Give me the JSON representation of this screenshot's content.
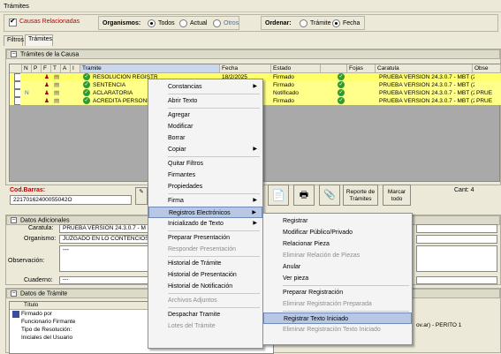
{
  "window": {
    "title": "Trámites"
  },
  "filters": {
    "causas_label": "Causas Relacionadas",
    "organismos_label": "Organismos:",
    "org_opts": [
      "Todos",
      "Actual",
      "Otros"
    ],
    "ordenar_label": "Ordenar:",
    "ord_opts": [
      "Trámite",
      "Fecha"
    ]
  },
  "tabs": [
    "Filtros",
    "Trámites"
  ],
  "tramites_panel": {
    "title": "Trámites de la Causa",
    "columns": [
      "N",
      "P",
      "F",
      "T",
      "A",
      "I",
      "Tramite",
      "Fecha",
      "Estado",
      "Fojas",
      "Caratula",
      "Obse"
    ],
    "rows": [
      {
        "tramite": "RESOLUCION REGISTRADA",
        "fecha": "18/2/2025",
        "estado": "Firmado",
        "caratula": "PRUEBA VERSION 24.3.0.7 - MBT (2)",
        "obs": ""
      },
      {
        "tramite": "SENTENCIA",
        "fecha": "18/2/2025",
        "estado": "Firmado",
        "caratula": "PRUEBA VERSION 24.3.0.7 - MBT (2)",
        "obs": ""
      },
      {
        "tramite": "ACLARATORIA",
        "fecha": "20/12/2024",
        "estado": "Notificado",
        "caratula": "PRUEBA VERSION 24.3.0.7 - MBT (2)",
        "obs": "PRUE"
      },
      {
        "tramite": "ACREDITA PERSONERIA",
        "fecha": "20/12/2024",
        "estado": "Firmado",
        "caratula": "PRUEBA VERSION 24.3.0.7 - MBT (2)",
        "obs": "PRUE"
      }
    ],
    "n_marker": "N"
  },
  "cod_barras": {
    "label": "Cod.Barras:",
    "value": "22170162400055042O"
  },
  "buttons": {
    "reporte": "Reporte de Trámites",
    "marcar": "Marcar todo"
  },
  "cant": "Cant: 4",
  "datos_adicionales": {
    "title": "Datos Adicionales",
    "caratula_label": "Caratula:",
    "caratula_value": "PRUEBA VERSION 24.3.0.7 - M",
    "organismo_label": "Organismo:",
    "organismo_value": "JUZGADO EN LO CONTENCIOSO",
    "observacion_label": "Observación:",
    "observacion_value": "---",
    "cuaderno_label": "Cuaderno:",
    "cuaderno_value": "---"
  },
  "datos_tramite": {
    "title": "Datos de Trámite",
    "col": "Título",
    "items": [
      "Firmado por",
      "Funcionario Firmante",
      "Tipo de Resolución:",
      "Iniciales del Usuario"
    ],
    "extra": "ov.ar) - PERITO 1"
  },
  "context_menu": [
    {
      "label": "Constancias",
      "sub": true,
      "dis": false
    },
    {
      "sep": true
    },
    {
      "label": "Abrir Texto",
      "dis": false
    },
    {
      "sep": true
    },
    {
      "label": "Agregar",
      "dis": false
    },
    {
      "label": "Modificar",
      "dis": false
    },
    {
      "label": "Borrar",
      "dis": false
    },
    {
      "label": "Copiar",
      "sub": true,
      "dis": false
    },
    {
      "sep": true
    },
    {
      "label": "Quitar Filtros",
      "dis": false
    },
    {
      "label": "Firmantes",
      "dis": false
    },
    {
      "label": "Propiedades",
      "dis": false
    },
    {
      "sep": true
    },
    {
      "label": "Firma",
      "sub": true,
      "dis": false
    },
    {
      "label": "Registros Electrónicos",
      "sub": true,
      "dis": false,
      "hl": true
    },
    {
      "label": "Inicializado de Texto",
      "sub": true,
      "dis": false
    },
    {
      "sep": true
    },
    {
      "label": "Preparar Presentación",
      "dis": false
    },
    {
      "label": "Responder Presentación",
      "dis": true
    },
    {
      "sep": true
    },
    {
      "label": "Historial de Trámite",
      "dis": false
    },
    {
      "label": "Historial de Presentación",
      "dis": false
    },
    {
      "label": "Historial de Notificación",
      "dis": false
    },
    {
      "sep": true
    },
    {
      "label": "Archivos Adjuntos",
      "dis": true
    },
    {
      "sep": true
    },
    {
      "label": "Despachar Tramite",
      "dis": false
    },
    {
      "label": "Lotes del Trámite",
      "dis": true
    }
  ],
  "submenu": [
    {
      "label": "Registrar",
      "dis": false
    },
    {
      "label": "Modificar Público/Privado",
      "dis": false
    },
    {
      "label": "Relacionar Pieza",
      "dis": false
    },
    {
      "label": "Eliminar Relación de Piezas",
      "dis": true
    },
    {
      "label": "Anular",
      "dis": false
    },
    {
      "label": "Ver pieza",
      "dis": false
    },
    {
      "sep": true
    },
    {
      "label": "Preparar Registración",
      "dis": false
    },
    {
      "label": "Eliminar Registración Preparada",
      "dis": true
    },
    {
      "sep": true
    },
    {
      "label": "Registrar Texto Iniciado",
      "dis": false,
      "hl": true
    },
    {
      "label": "Eliminar Registración Texto Iniciado",
      "dis": true
    }
  ],
  "colors": {
    "row_yellow": "#ffff66",
    "highlight": "#b8c8e4",
    "red_label": "#c00000"
  }
}
